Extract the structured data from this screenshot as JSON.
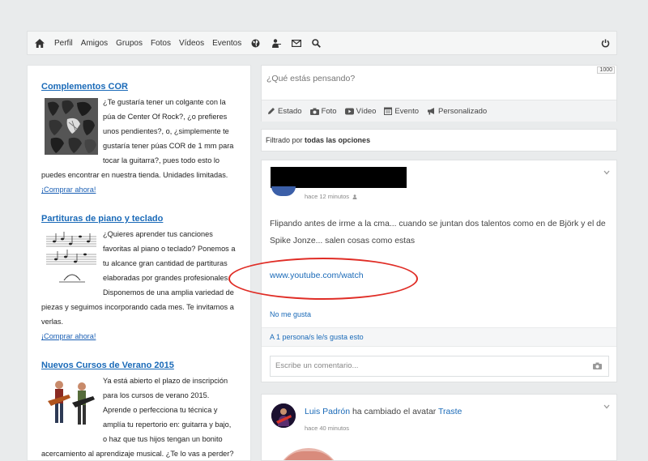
{
  "nav": {
    "links": [
      "Perfil",
      "Amigos",
      "Grupos",
      "Fotos",
      "Vídeos",
      "Eventos"
    ],
    "icons": [
      "home-icon",
      "globe-icon",
      "people-icon",
      "mail-icon",
      "search-icon",
      "power-icon"
    ]
  },
  "ads": [
    {
      "title": "Complementos COR",
      "body": "¿Te gustaría tener un colgante con la púa de Center Of Rock?, ¿o prefieres unos pendientes?, o, ¿simplemente te gustaría tener púas COR de 1 mm para tocar la guitarra?, pues todo esto lo puedes encontrar en nuestra tienda. Unidades limitadas.",
      "link": "¡Comprar ahora!"
    },
    {
      "title": "Partituras de piano y teclado",
      "body": "¿Quieres aprender tus canciones favoritas al piano o teclado? Ponemos a tu alcance gran cantidad de partituras elaboradas por grandes profesionales. Disponemos de una amplia variedad de piezas y seguimos incorporando cada mes. Te invitamos a verlas.",
      "link": "¡Comprar ahora!"
    },
    {
      "title": "Nuevos Cursos de Verano 2015",
      "body": "Ya está abierto el plazo de inscripción para los cursos de verano 2015. Aprende o perfecciona tu técnica y amplía tu repertorio en: guitarra y bajo, o haz que tus hijos tengan un bonito acercamiento al aprendizaje musical. ¿Te lo vas a perder?"
    }
  ],
  "composer": {
    "placeholder": "¿Qué estás pensando?",
    "counter": "1000",
    "options": [
      "Estado",
      "Foto",
      "Vídeo",
      "Evento",
      "Personalizado"
    ]
  },
  "filter": {
    "prefix": "Filtrado por",
    "value": "todas las opciones"
  },
  "post1": {
    "time": "hace 12 minutos",
    "text": "Flipando antes de irme a la cma... cuando se juntan dos talentos como en de Björk y el de Spike Jonze... salen cosas como estas",
    "link": "www.youtube.com/watch",
    "unlike": "No me gusta",
    "likes": "A 1 persona/s le/s gusta esto",
    "comment_placeholder": "Escribe un comentario..."
  },
  "post2": {
    "author": "Luis Padrón",
    "action": " ha cambiado el avatar ",
    "target": "Traste",
    "time": "hace 40 minutos"
  },
  "colors": {
    "link": "#1a6ab8",
    "highlight": "#e02d26"
  }
}
